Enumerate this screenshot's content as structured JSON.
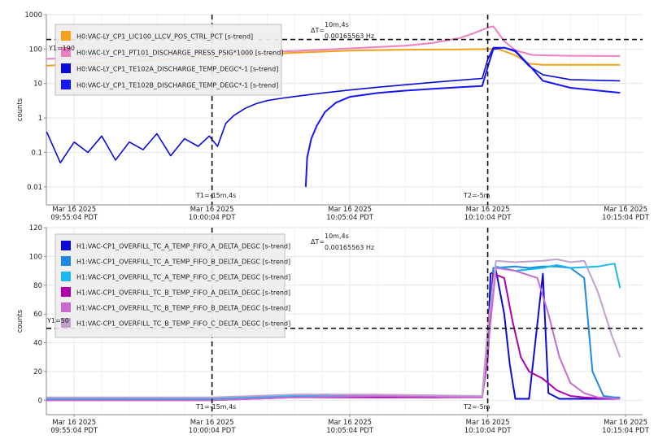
{
  "chart_data": [
    {
      "type": "line",
      "ylabel": "counts",
      "yscale": "log",
      "ylim": [
        0.003,
        1000
      ],
      "yticks": [
        {
          "v": 0.01,
          "label": "0.01"
        },
        {
          "v": 0.1,
          "label": "0.1"
        },
        {
          "v": 1,
          "label": "1"
        },
        {
          "v": 10,
          "label": "10"
        },
        {
          "v": 100,
          "label": "100"
        },
        {
          "v": 1000,
          "label": "1000"
        }
      ],
      "xlim": [
        -1,
        20.5
      ],
      "xticks": [
        {
          "v": 0,
          "date": "Mar 16 2025",
          "time": "09:55:04 PDT"
        },
        {
          "v": 5,
          "date": "Mar 16 2025",
          "time": "10:00:04 PDT"
        },
        {
          "v": 10,
          "date": "Mar 16 2025",
          "time": "10:05:04 PDT"
        },
        {
          "v": 15,
          "date": "Mar 16 2025",
          "time": "10:10:04 PDT"
        },
        {
          "v": 20,
          "date": "Mar 16 2025",
          "time": "10:15:04 PDT"
        }
      ],
      "cursors": {
        "t1": {
          "x": 5,
          "label": "T1=-15m,4s"
        },
        "t2": {
          "x": 15,
          "label": "T2=-5m"
        },
        "y1": {
          "y": 190,
          "label": "Y1=190"
        },
        "delta_t": {
          "label": "ΔT=",
          "value": "10m,4s",
          "freq": "0.00165563 Hz"
        }
      },
      "grid": true,
      "legend_position": "top-left",
      "series": [
        {
          "name": "H0:VAC-LY_CP1_LIC100_LLCV_POS_CTRL_PCT [s-trend]",
          "color": "#f5a21b",
          "width": 2,
          "x": [
            -1,
            0,
            2,
            4,
            5,
            6,
            8,
            10,
            12,
            14,
            15,
            15.4,
            16,
            16.5,
            17,
            19.8
          ],
          "y": [
            33,
            36,
            44,
            54,
            58,
            64,
            78,
            90,
            96,
            98,
            100,
            100,
            66,
            38,
            35,
            35
          ]
        },
        {
          "name": "H0:VAC-LY_CP1_PT101_DISCHARGE_PRESS_PSIG*1000 [s-trend]",
          "color": "#f07fbf",
          "width": 2,
          "x": [
            -1,
            0,
            2,
            4,
            5,
            6,
            8,
            10,
            12,
            13,
            14,
            14.5,
            15,
            15.2,
            15.6,
            16,
            16.6,
            17,
            18,
            19.8
          ],
          "y": [
            52,
            55,
            60,
            66,
            70,
            76,
            88,
            105,
            125,
            150,
            210,
            290,
            420,
            460,
            170,
            92,
            68,
            66,
            64,
            63
          ]
        },
        {
          "name": "H0:VAC-LY_CP1_TE102A_DISCHARGE_TEMP_DEGC*-1 [s-trend]",
          "color": "#0b0bd8",
          "width": 1.6,
          "x": [
            -1,
            -0.5,
            0,
            0.5,
            1,
            1.5,
            2,
            2.5,
            3,
            3.5,
            4,
            4.5,
            4.9,
            5.2,
            5.5,
            5.8,
            6.2,
            6.6,
            7,
            7.5,
            8,
            9,
            10,
            11,
            12,
            13,
            14,
            14.8,
            15,
            15.2,
            15.6,
            16,
            16.5,
            17,
            18,
            19.8
          ],
          "y": [
            0.4,
            0.05,
            0.2,
            0.1,
            0.3,
            0.06,
            0.2,
            0.12,
            0.35,
            0.08,
            0.25,
            0.15,
            0.3,
            0.15,
            0.7,
            1.2,
            1.9,
            2.6,
            3.2,
            3.7,
            4.2,
            5.3,
            6.5,
            7.8,
            9.2,
            10.8,
            12.5,
            14,
            50,
            110,
            110,
            85,
            32,
            18,
            13,
            12
          ]
        },
        {
          "name": "H0:VAC-LY_CP1_TE102B_DISCHARGE_TEMP_DEGC*-1 [s-trend]",
          "color": "#1515ff",
          "width": 2,
          "x": [
            8.4,
            8.45,
            8.6,
            8.8,
            9.1,
            9.5,
            10,
            11,
            12,
            13,
            14,
            14.8,
            15,
            15.2,
            15.6,
            16,
            16.6,
            17,
            18,
            19.8
          ],
          "y": [
            0.01,
            0.07,
            0.25,
            0.6,
            1.5,
            2.8,
            4.1,
            5.3,
            6.2,
            7.0,
            7.8,
            8.5,
            30,
            100,
            110,
            90,
            28,
            12,
            7.5,
            5.4
          ]
        }
      ]
    },
    {
      "type": "line",
      "ylabel": "counts",
      "yscale": "linear",
      "ylim": [
        -10,
        120
      ],
      "yticks": [
        {
          "v": 0,
          "label": "0"
        },
        {
          "v": 20,
          "label": "20"
        },
        {
          "v": 40,
          "label": "40"
        },
        {
          "v": 60,
          "label": "60"
        },
        {
          "v": 80,
          "label": "80"
        },
        {
          "v": 100,
          "label": "100"
        },
        {
          "v": 120,
          "label": "120"
        }
      ],
      "xlim": [
        -1,
        20.5
      ],
      "xticks": [
        {
          "v": 0,
          "date": "Mar 16 2025",
          "time": "09:55:04 PDT"
        },
        {
          "v": 5,
          "date": "Mar 16 2025",
          "time": "10:00:04 PDT"
        },
        {
          "v": 10,
          "date": "Mar 16 2025",
          "time": "10:05:04 PDT"
        },
        {
          "v": 15,
          "date": "Mar 16 2025",
          "time": "10:10:04 PDT"
        },
        {
          "v": 20,
          "date": "Mar 16 2025",
          "time": "10:15:04 PDT"
        }
      ],
      "cursors": {
        "t1": {
          "x": 5,
          "label": "T1=-15m,4s"
        },
        "t2": {
          "x": 15,
          "label": "T2=-5m"
        },
        "y1": {
          "y": 50,
          "label": "Y1=50"
        },
        "delta_t": {
          "label": "ΔT=",
          "value": "10m,4s",
          "freq": "0.00165563 Hz"
        }
      },
      "grid": true,
      "legend_position": "top-left",
      "series": [
        {
          "name": "H1:VAC-CP1_OVERFILL_TC_A_TEMP_FIFO_A_DELTA_DEGC [s-trend]",
          "color": "#0b0bd8",
          "width": 2,
          "x": [
            -1,
            5,
            7,
            9,
            11,
            13,
            14.8,
            15,
            15.1,
            15.3,
            15.6,
            15.8,
            16,
            16.2,
            16.5,
            17,
            17.2,
            17.6,
            18,
            19.8
          ],
          "y": [
            1,
            1,
            2,
            4,
            3,
            2,
            3,
            30,
            88,
            90,
            60,
            25,
            1,
            1,
            1,
            88,
            5,
            1,
            1,
            1
          ]
        },
        {
          "name": "H1:VAC-CP1_OVERFILL_TC_A_TEMP_FIFO_B_DELTA_DEGC [s-trend]",
          "color": "#1e88e5",
          "width": 2,
          "x": [
            -1,
            5,
            8,
            11,
            14.8,
            15,
            15.2,
            16,
            16.5,
            17,
            17.5,
            18,
            18.5,
            18.8,
            19.2,
            19.6,
            19.8
          ],
          "y": [
            1,
            1,
            3,
            3,
            3,
            40,
            92,
            93,
            92,
            93,
            93,
            92,
            85,
            20,
            3,
            2,
            2
          ]
        },
        {
          "name": "H1:VAC-CP1_OVERFILL_TC_A_TEMP_FIFO_C_DELTA_DEGC [s-trend]",
          "color": "#18b8f2",
          "width": 2,
          "x": [
            -1,
            5,
            8,
            11,
            14.8,
            15,
            15.3,
            16,
            17,
            17.5,
            18,
            19,
            19.6,
            19.8
          ],
          "y": [
            1,
            1,
            3,
            3,
            3,
            45,
            93,
            90,
            92,
            94,
            92,
            93,
            95,
            78
          ]
        },
        {
          "name": "H1:VAC-CP1_OVERFILL_TC_B_TEMP_FIFO_A_DELTA_DEGC [s-trend]",
          "color": "#b000b0",
          "width": 2,
          "x": [
            -1,
            5,
            8,
            11,
            14.8,
            15,
            15.2,
            15.6,
            15.9,
            16.2,
            16.5,
            17,
            17.5,
            18,
            18.5,
            19,
            19.8
          ],
          "y": [
            0,
            0,
            2,
            2,
            2,
            30,
            88,
            85,
            55,
            30,
            20,
            15,
            7,
            3,
            2,
            1.5,
            1
          ]
        },
        {
          "name": "H1:VAC-CP1_OVERFILL_TC_B_TEMP_FIFO_B_DELTA_DEGC [s-trend]",
          "color": "#c86ad0",
          "width": 2,
          "x": [
            -1,
            5,
            8,
            11,
            14.8,
            15,
            15.3,
            16,
            16.8,
            17.2,
            17.6,
            18,
            18.5,
            19,
            19.8
          ],
          "y": [
            0,
            0,
            2,
            3,
            2,
            35,
            92,
            90,
            85,
            60,
            30,
            12,
            5,
            2,
            1
          ]
        },
        {
          "name": "H1:VAC-CP1_OVERFILL_TC_B_TEMP_FIFO_C_DELTA_DEGC [s-trend]",
          "color": "#c0a0cc",
          "width": 2,
          "x": [
            -1,
            5,
            8,
            11,
            14.8,
            15,
            15.3,
            16,
            17,
            17.5,
            18,
            18.5,
            19,
            19.5,
            19.8
          ],
          "y": [
            2,
            2,
            4,
            4,
            3,
            50,
            97,
            96,
            97,
            98,
            96,
            97,
            75,
            45,
            30
          ]
        }
      ]
    }
  ]
}
